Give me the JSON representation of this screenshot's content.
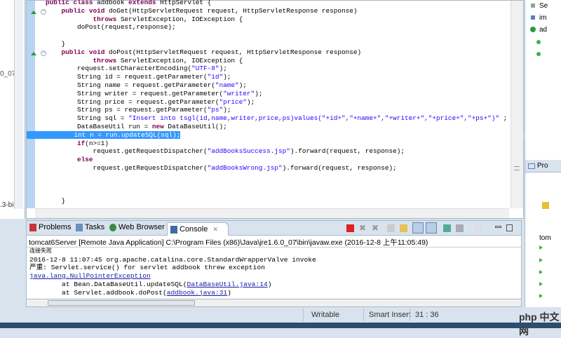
{
  "editor": {
    "lines": [
      {
        "parts": [
          [
            "kw",
            "public class "
          ],
          [
            "",
            "addbook "
          ],
          [
            "kw",
            "extends "
          ],
          [
            "",
            "HttpServlet {"
          ]
        ]
      },
      {
        "parts": [
          [
            "",
            "    "
          ],
          [
            "kw",
            "public void "
          ],
          [
            "",
            "doGet(HttpServletRequest request, HttpServletResponse response)"
          ]
        ]
      },
      {
        "parts": [
          [
            "",
            "            "
          ],
          [
            "kw",
            "throws "
          ],
          [
            "",
            "ServletException, IOException {"
          ]
        ]
      },
      {
        "parts": [
          [
            "",
            "        doPost(request,response);"
          ]
        ]
      },
      {
        "parts": [
          [
            "",
            ""
          ]
        ]
      },
      {
        "parts": [
          [
            "",
            "    }"
          ]
        ]
      },
      {
        "parts": [
          [
            "",
            "    "
          ],
          [
            "kw",
            "public void "
          ],
          [
            "",
            "doPost(HttpServletRequest request, HttpServletResponse response)"
          ]
        ]
      },
      {
        "parts": [
          [
            "",
            "            "
          ],
          [
            "kw",
            "throws "
          ],
          [
            "",
            "ServletException, IOException {"
          ]
        ]
      },
      {
        "parts": [
          [
            "",
            "        request.setCharacterEncoding("
          ],
          [
            "str",
            "\"UTF-8\""
          ],
          [
            "",
            ");"
          ]
        ]
      },
      {
        "parts": [
          [
            "",
            "        String id = request.getParameter("
          ],
          [
            "str",
            "\"id\""
          ],
          [
            "",
            ");"
          ]
        ]
      },
      {
        "parts": [
          [
            "",
            "        String name = request.getParameter("
          ],
          [
            "str",
            "\"name\""
          ],
          [
            "",
            ");"
          ]
        ]
      },
      {
        "parts": [
          [
            "",
            "        String writer = request.getParameter("
          ],
          [
            "str",
            "\"writer\""
          ],
          [
            "",
            ");"
          ]
        ]
      },
      {
        "parts": [
          [
            "",
            "        String price = request.getParameter("
          ],
          [
            "str",
            "\"price\""
          ],
          [
            "",
            ");"
          ]
        ]
      },
      {
        "parts": [
          [
            "",
            "        String ps = request.getParameter("
          ],
          [
            "str",
            "\"ps\""
          ],
          [
            "",
            ");"
          ]
        ]
      },
      {
        "parts": [
          [
            "",
            "        String sql = "
          ],
          [
            "str",
            "\"Insert into tsgl(id,name,writer,price,ps)values(\"+id+\",\"+name+\",\"+writer+\",\"+price+\",\"+ps+\")\""
          ],
          [
            "",
            " ;"
          ]
        ]
      },
      {
        "parts": [
          [
            "",
            "        DataBaseUtil run = "
          ],
          [
            "kw",
            "new "
          ],
          [
            "",
            "DataBaseUtil();"
          ]
        ]
      },
      {
        "parts": [
          [
            "sel",
            "        int n = run.updateSQL(sql);"
          ]
        ],
        "current": true
      },
      {
        "parts": [
          [
            "",
            "        "
          ],
          [
            "kw",
            "if"
          ],
          [
            "",
            "(n>=1)"
          ]
        ]
      },
      {
        "parts": [
          [
            "",
            "            request.getRequestDispatcher("
          ],
          [
            "str",
            "\"addBooksSuccess.jsp\""
          ],
          [
            "",
            ").forward(request, response);"
          ]
        ]
      },
      {
        "parts": [
          [
            "",
            "        "
          ],
          [
            "kw",
            "else"
          ]
        ]
      },
      {
        "parts": [
          [
            "",
            "            request.getRequestDispatcher("
          ],
          [
            "str",
            "\"addBooksWrong.jsp\""
          ],
          [
            "",
            ").forward(request, response);"
          ]
        ]
      },
      {
        "parts": [
          [
            "",
            ""
          ]
        ]
      },
      {
        "parts": [
          [
            "",
            ""
          ]
        ]
      },
      {
        "parts": [
          [
            "",
            ""
          ]
        ]
      },
      {
        "parts": [
          [
            "",
            "    }"
          ]
        ]
      }
    ]
  },
  "left_panel": {
    "fragment1": "0_07",
    "fragment2": ".3-bi"
  },
  "console": {
    "tabs": [
      "Problems",
      "Tasks",
      "Web Browser",
      "Console"
    ],
    "title": "tomcat6Server [Remote Java Application] C:\\Program Files (x86)\\Java\\jre1.6.0_07\\bin\\javaw.exe (2016-12-8 上午11:05:49)",
    "lines": [
      {
        "text": "连接失败"
      },
      {
        "text": "2016-12-8 11:07:45 org.apache.catalina.core.StandardWrapperValve invoke"
      },
      {
        "text": "严重: Servlet.service() for servlet addbook threw exception"
      },
      {
        "link": "java.lang.NullPointerException"
      },
      {
        "text": "\tat Bean.DataBaseUtil.updateSQL(",
        "link": "DataBaseUtil.java:14",
        "tail": ")"
      },
      {
        "text": "\tat Servlet.addbook.doPost(",
        "link": "addbook.java:31",
        "tail": ")"
      }
    ]
  },
  "status": {
    "writable": "Writable",
    "insert_mode": "Smart Insert",
    "position": "31 : 36"
  },
  "right_panel": {
    "outline": [
      "Se",
      "im",
      "ad"
    ],
    "tabs": [
      "Pro"
    ],
    "debug_item": "tom"
  },
  "watermark": "php 中文网"
}
